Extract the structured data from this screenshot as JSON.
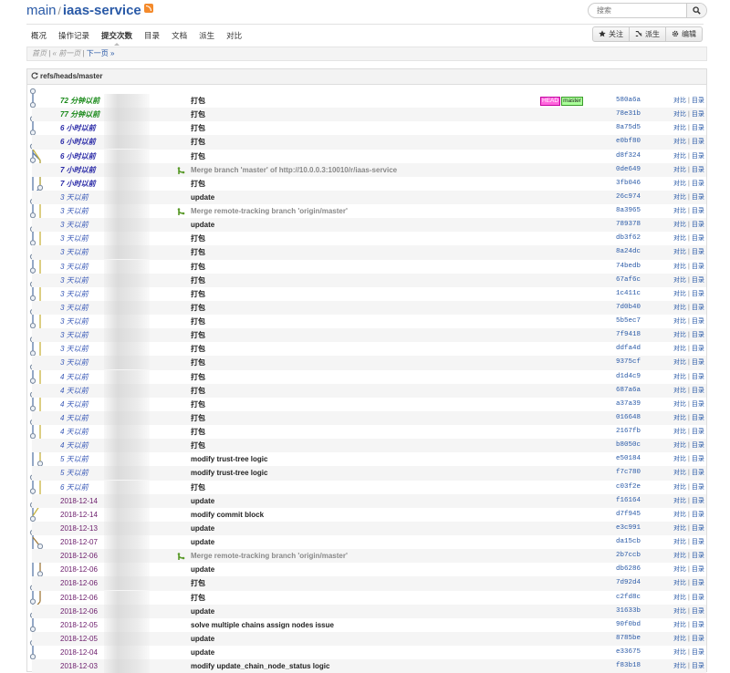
{
  "header": {
    "repo_prefix": "main",
    "separator": "/",
    "project": "iaas-service",
    "search_placeholder": "搜索"
  },
  "tabs": [
    {
      "label": "概况"
    },
    {
      "label": "操作记录"
    },
    {
      "label": "提交次数",
      "active": true
    },
    {
      "label": "目录"
    },
    {
      "label": "文档"
    },
    {
      "label": "派生"
    },
    {
      "label": "对比"
    }
  ],
  "actions": [
    {
      "label": "关注",
      "icon": "star-icon"
    },
    {
      "label": "派生",
      "icon": "fork-icon"
    },
    {
      "label": "编辑",
      "icon": "gear-icon"
    }
  ],
  "pager": {
    "first": "首页",
    "sep1": "|",
    "prev": "« 前一页",
    "sep2": "|",
    "next": "下一页 »"
  },
  "panel": {
    "ref": "refs/heads/master"
  },
  "row_links": {
    "compare": "对比",
    "sep": "|",
    "tree": "目录"
  },
  "commits": [
    {
      "age": "72 分钟以前",
      "age_class": "hot",
      "msg": "打包",
      "sha": "580a6a",
      "refs": [
        "HEAD",
        "master"
      ]
    },
    {
      "age": "77 分钟以前",
      "age_class": "hot",
      "msg": "打包",
      "sha": "78e31b"
    },
    {
      "age": "6 小时以前",
      "age_class": "hours",
      "msg": "打包",
      "sha": "8a75d5"
    },
    {
      "age": "6 小时以前",
      "age_class": "hours",
      "msg": "打包",
      "sha": "e0bf80"
    },
    {
      "age": "6 小时以前",
      "age_class": "hours",
      "msg": "打包",
      "sha": "d8f324"
    },
    {
      "age": "7 小时以前",
      "age_class": "hours",
      "msg": "Merge branch 'master' of http://10.0.0.3:10010/r/iaas-service",
      "sha": "0de649",
      "merge": true
    },
    {
      "age": "7 小时以前",
      "age_class": "hours",
      "msg": "打包",
      "sha": "3fb046"
    },
    {
      "age": "3 天以前",
      "age_class": "days",
      "msg": "update",
      "sha": "26c974"
    },
    {
      "age": "3 天以前",
      "age_class": "days",
      "msg": "Merge remote-tracking branch 'origin/master'",
      "sha": "8a3965",
      "merge": true
    },
    {
      "age": "3 天以前",
      "age_class": "days",
      "msg": "update",
      "sha": "789378"
    },
    {
      "age": "3 天以前",
      "age_class": "days",
      "msg": "打包",
      "sha": "db3f62"
    },
    {
      "age": "3 天以前",
      "age_class": "days",
      "msg": "打包",
      "sha": "8a24dc"
    },
    {
      "age": "3 天以前",
      "age_class": "days",
      "msg": "打包",
      "sha": "74bedb"
    },
    {
      "age": "3 天以前",
      "age_class": "days",
      "msg": "打包",
      "sha": "67af6c"
    },
    {
      "age": "3 天以前",
      "age_class": "days",
      "msg": "打包",
      "sha": "1c411c"
    },
    {
      "age": "3 天以前",
      "age_class": "days",
      "msg": "打包",
      "sha": "7d0b40"
    },
    {
      "age": "3 天以前",
      "age_class": "days",
      "msg": "打包",
      "sha": "5b5ec7"
    },
    {
      "age": "3 天以前",
      "age_class": "days",
      "msg": "打包",
      "sha": "7f9418"
    },
    {
      "age": "3 天以前",
      "age_class": "days",
      "msg": "打包",
      "sha": "ddfa4d"
    },
    {
      "age": "3 天以前",
      "age_class": "days",
      "msg": "打包",
      "sha": "9375cf"
    },
    {
      "age": "4 天以前",
      "age_class": "days",
      "msg": "打包",
      "sha": "d1d4c9"
    },
    {
      "age": "4 天以前",
      "age_class": "days",
      "msg": "打包",
      "sha": "687a6a"
    },
    {
      "age": "4 天以前",
      "age_class": "days",
      "msg": "打包",
      "sha": "a37a39"
    },
    {
      "age": "4 天以前",
      "age_class": "days",
      "msg": "打包",
      "sha": "016648"
    },
    {
      "age": "4 天以前",
      "age_class": "days",
      "msg": "打包",
      "sha": "2167fb"
    },
    {
      "age": "4 天以前",
      "age_class": "days",
      "msg": "打包",
      "sha": "b8050c"
    },
    {
      "age": "5 天以前",
      "age_class": "days",
      "msg": "modify trust-tree logic",
      "sha": "e50184"
    },
    {
      "age": "5 天以前",
      "age_class": "days",
      "msg": "modify trust-tree logic",
      "sha": "f7c780"
    },
    {
      "age": "6 天以前",
      "age_class": "days",
      "msg": "打包",
      "sha": "c03f2e"
    },
    {
      "age": "2018-12-14",
      "age_class": "date",
      "msg": "update",
      "sha": "f16164"
    },
    {
      "age": "2018-12-14",
      "age_class": "date",
      "msg": "modify commit block",
      "sha": "d7f945"
    },
    {
      "age": "2018-12-13",
      "age_class": "date",
      "msg": "update",
      "sha": "e3c991"
    },
    {
      "age": "2018-12-07",
      "age_class": "date",
      "msg": "update",
      "sha": "da15cb"
    },
    {
      "age": "2018-12-06",
      "age_class": "date",
      "msg": "Merge remote-tracking branch 'origin/master'",
      "sha": "2b7ccb",
      "merge": true
    },
    {
      "age": "2018-12-06",
      "age_class": "date",
      "msg": "update",
      "sha": "db6286"
    },
    {
      "age": "2018-12-06",
      "age_class": "date",
      "msg": "打包",
      "sha": "7d92d4"
    },
    {
      "age": "2018-12-06",
      "age_class": "date",
      "msg": "打包",
      "sha": "c2fd8c"
    },
    {
      "age": "2018-12-06",
      "age_class": "date",
      "msg": "update",
      "sha": "31633b"
    },
    {
      "age": "2018-12-05",
      "age_class": "date",
      "msg": "solve multiple chains assign nodes issue",
      "sha": "90f0bd"
    },
    {
      "age": "2018-12-05",
      "age_class": "date",
      "msg": "update",
      "sha": "8785be"
    },
    {
      "age": "2018-12-04",
      "age_class": "date",
      "msg": "update",
      "sha": "e33675"
    },
    {
      "age": "2018-12-03",
      "age_class": "date",
      "msg": "modify update_chain_node_status logic",
      "sha": "f83b18"
    }
  ],
  "colors": {
    "link": "#2a5aa7",
    "graph_main": "#5a7aa7",
    "graph_side": "#c8b440",
    "graph_merge": "#a07a3a"
  }
}
